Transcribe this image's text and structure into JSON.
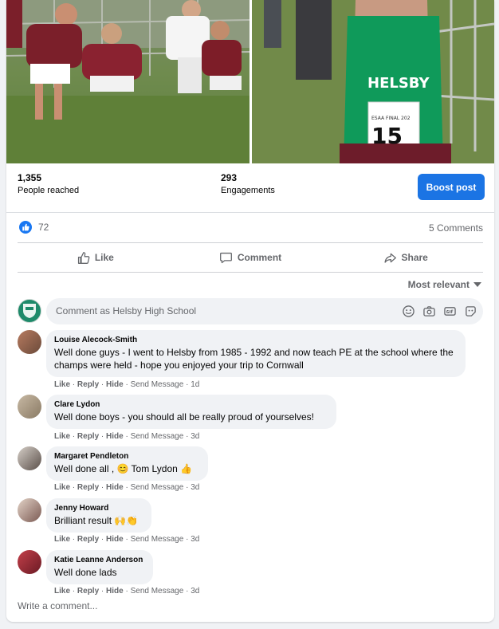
{
  "stats": {
    "reached_value": "1,355",
    "reached_label": "People reached",
    "engagements_value": "293",
    "engagements_label": "Engagements",
    "boost_label": "Boost post"
  },
  "reactions": {
    "count": "72",
    "comments": "5 Comments"
  },
  "actions": {
    "like": "Like",
    "comment": "Comment",
    "share": "Share"
  },
  "sort_label": "Most relevant",
  "composer": {
    "placeholder": "Comment as Helsby High School"
  },
  "photo_text": {
    "shirt": "HELSBY",
    "bib_top": "ESAA FINAL 202",
    "bib_number": "15"
  },
  "comments": [
    {
      "author": "Louise Alecock-Smith",
      "text": "Well done guys - I went to Helsby from 1985 - 1992 and now teach PE at the school where the champs were held - hope you enjoyed your trip to Cornwall",
      "time": "1d"
    },
    {
      "author": "Clare Lydon",
      "text": "Well done boys - you should all be really proud of yourselves!",
      "time": "3d"
    },
    {
      "author": "Margaret Pendleton",
      "text": "Well done all , 😊 Tom Lydon 👍",
      "time": "3d"
    },
    {
      "author": "Jenny Howard",
      "text": "Brilliant result 🙌👏",
      "time": "3d"
    },
    {
      "author": "Katie Leanne Anderson",
      "text": "Well done lads",
      "time": "3d"
    }
  ],
  "meta": {
    "like": "Like",
    "reply": "Reply",
    "hide": "Hide",
    "send": "Send Message"
  },
  "write_comment": "Write a comment..."
}
